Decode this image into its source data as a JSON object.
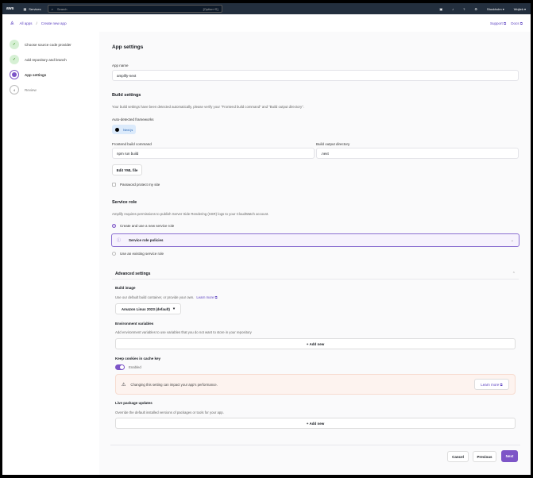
{
  "topnav": {
    "logo": "aws",
    "services": "Services",
    "search_placeholder": "Search",
    "search_shortcut": "[Option+S]",
    "region": "Stockholm ▾",
    "user": "Wojtek ▾"
  },
  "breadcrumb": {
    "all_apps": "All apps",
    "separator": "/",
    "current": "Create new app",
    "support": "Support ⧉",
    "docs": "Docs ⧉"
  },
  "steps": [
    {
      "label": "Choose source code provider",
      "state": "done"
    },
    {
      "label": "Add repository and branch",
      "state": "done"
    },
    {
      "label": "App settings",
      "state": "current"
    },
    {
      "label": "Review",
      "number": "4",
      "state": "todo"
    }
  ],
  "main": {
    "title": "App settings",
    "app_name_label": "App name",
    "app_name_value": "amplify-next",
    "build_title": "Build settings",
    "build_desc": "Your build settings have been detected automatically, please verify your \"Frontend build command\" and \"Build output directory\".",
    "frameworks_label": "Auto-detected frameworks",
    "framework": "Next.js",
    "build_cmd_label": "Frontend build command",
    "build_cmd_value": "npm run build",
    "output_label": "Build output directory",
    "output_value": ".next",
    "edit_yml": "Edit YML file",
    "password_label": "Password protect my site",
    "service_title": "Service role",
    "service_desc": "Amplify requires permissions to publish Server Side Rendering (SSR) logs to your CloudWatch account.",
    "radio_new": "Create and use a new service role",
    "policies": "Service role policies",
    "radio_existing": "Use an existing service role",
    "advanced": "Advanced settings",
    "build_image_title": "Build image",
    "build_image_desc": "Use our default build container, or provide your own.",
    "learn_more": "Learn more ⧉",
    "build_image_value": "Amazon Linux 2023 (default)",
    "env_title": "Environment variables",
    "env_desc": "Add environment variables to use variables that you do not want to store in your repository",
    "add_new": "+ Add new",
    "cookies_title": "Keep cookies in cache key",
    "cookies_state": "Enabled",
    "warning": "Changing this setting can impact your app's performance.",
    "warning_learn": "Learn more ⧉",
    "live_title": "Live package updates",
    "live_desc": "Override the default installed versions of packages or tools for your app.",
    "cancel": "Cancel",
    "previous": "Previous",
    "next": "Next"
  }
}
